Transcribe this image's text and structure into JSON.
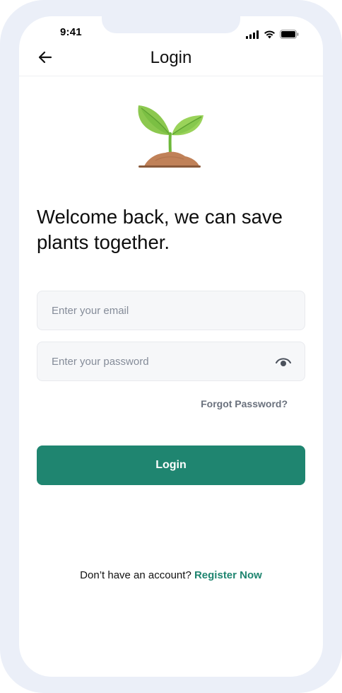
{
  "status_bar": {
    "time": "9:41"
  },
  "header": {
    "title": "Login",
    "back_icon": "arrow-left-icon"
  },
  "illustration": {
    "icon": "seedling-icon",
    "colors": {
      "leaf_light": "#9ad35a",
      "leaf_dark": "#6db83a",
      "soil": "#c08158",
      "ground": "#8a5a3b"
    }
  },
  "welcome": {
    "heading": "Welcome back, we can save plants together."
  },
  "form": {
    "email_placeholder": "Enter your email",
    "password_placeholder": "Enter your password",
    "password_toggle_icon": "eye-icon",
    "forgot_password": "Forgot Password?",
    "submit_label": "Login"
  },
  "footer": {
    "prompt": "Don’t have an account?",
    "register_label": "Register Now"
  },
  "colors": {
    "accent": "#1f8570",
    "frame": "#ebeff8",
    "input_bg": "#f6f7f9"
  }
}
